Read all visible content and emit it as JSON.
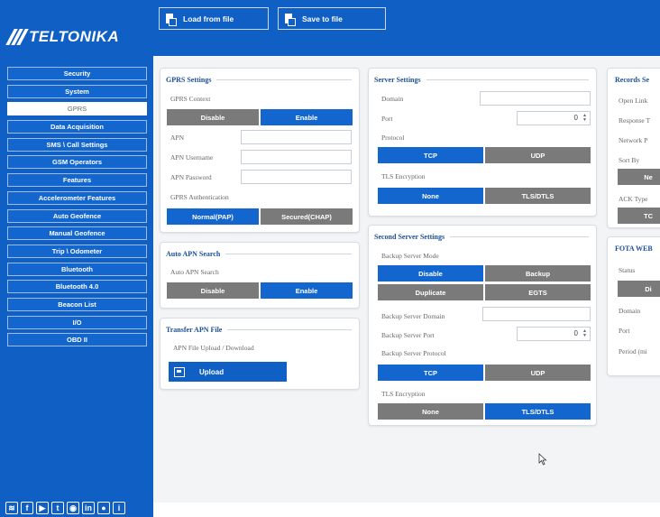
{
  "brand": {
    "logo_text": "TELTONIKA"
  },
  "toolbar": {
    "load_label": "Load from file",
    "save_label": "Save to file"
  },
  "sidebar": {
    "items": [
      {
        "label": "Security"
      },
      {
        "label": "System"
      },
      {
        "label": "GPRS",
        "active": true
      },
      {
        "label": "Data Acquisition"
      },
      {
        "label": "SMS \\ Call Settings"
      },
      {
        "label": "GSM Operators"
      },
      {
        "label": "Features"
      },
      {
        "label": "Accelerometer Features"
      },
      {
        "label": "Auto Geofence"
      },
      {
        "label": "Manual Geofence"
      },
      {
        "label": "Trip \\ Odometer"
      },
      {
        "label": "Bluetooth"
      },
      {
        "label": "Bluetooth 4.0"
      },
      {
        "label": "Beacon List"
      },
      {
        "label": "I/O"
      },
      {
        "label": "OBD II"
      }
    ]
  },
  "footer": {
    "icons": [
      "teltonika-icon",
      "facebook-icon",
      "youtube-icon",
      "twitter-icon",
      "rss-icon",
      "linkedin-icon",
      "flickr-icon",
      "info-icon"
    ]
  },
  "gprs": {
    "title": "GPRS Settings",
    "context_label": "GPRS Context",
    "context_options": [
      "Disable",
      "Enable"
    ],
    "context_selected": "Enable",
    "apn_label": "APN",
    "apn_value": "",
    "apn_user_label": "APN Username",
    "apn_user_value": "",
    "apn_pass_label": "APN Password",
    "apn_pass_value": "",
    "auth_label": "GPRS Authentication",
    "auth_options": [
      "Normal(PAP)",
      "Secured(CHAP)"
    ],
    "auth_selected": "Normal(PAP)"
  },
  "auto_apn": {
    "title": "Auto APN Search",
    "label": "Auto APN Search",
    "options": [
      "Disable",
      "Enable"
    ],
    "selected": "Enable"
  },
  "transfer_apn": {
    "title": "Transfer APN File",
    "label": "APN File Upload / Download",
    "upload_label": "Upload"
  },
  "server": {
    "title": "Server Settings",
    "domain_label": "Domain",
    "domain_value": "",
    "port_label": "Port",
    "port_value": "0",
    "protocol_label": "Protocol",
    "protocol_options": [
      "TCP",
      "UDP"
    ],
    "protocol_selected": "TCP",
    "tls_label": "TLS Encryption",
    "tls_options": [
      "None",
      "TLS/DTLS"
    ],
    "tls_selected": "None"
  },
  "second_server": {
    "title": "Second Server Settings",
    "mode_label": "Backup Server Mode",
    "mode_options": [
      "Disable",
      "Backup",
      "Duplicate",
      "EGTS"
    ],
    "mode_selected": "Disable",
    "domain_label": "Backup Server Domain",
    "domain_value": "",
    "port_label": "Backup Server Port",
    "port_value": "0",
    "protocol_label": "Backup Server Protocol",
    "protocol_options": [
      "TCP",
      "UDP"
    ],
    "protocol_selected": "TCP",
    "tls_label": "TLS Encryption",
    "tls_options": [
      "None",
      "TLS/DTLS"
    ],
    "tls_selected": "TLS/DTLS"
  },
  "records": {
    "title": "Records Se",
    "open_link_label": "Open Link",
    "response_label": "Response T",
    "network_label": "Network P",
    "sort_label": "Sort By",
    "sort_btn": "Ne",
    "ack_label": "ACK Type",
    "ack_btn": "TC"
  },
  "fota": {
    "title": "FOTA WEB",
    "status_label": "Status",
    "status_btn": "Di",
    "domain_label": "Domain",
    "port_label": "Port",
    "period_label": "Period (mi"
  },
  "colors": {
    "brand_blue": "#0f5fc4",
    "active_blue": "#1466cf",
    "inactive_gray": "#7a7a7a"
  }
}
